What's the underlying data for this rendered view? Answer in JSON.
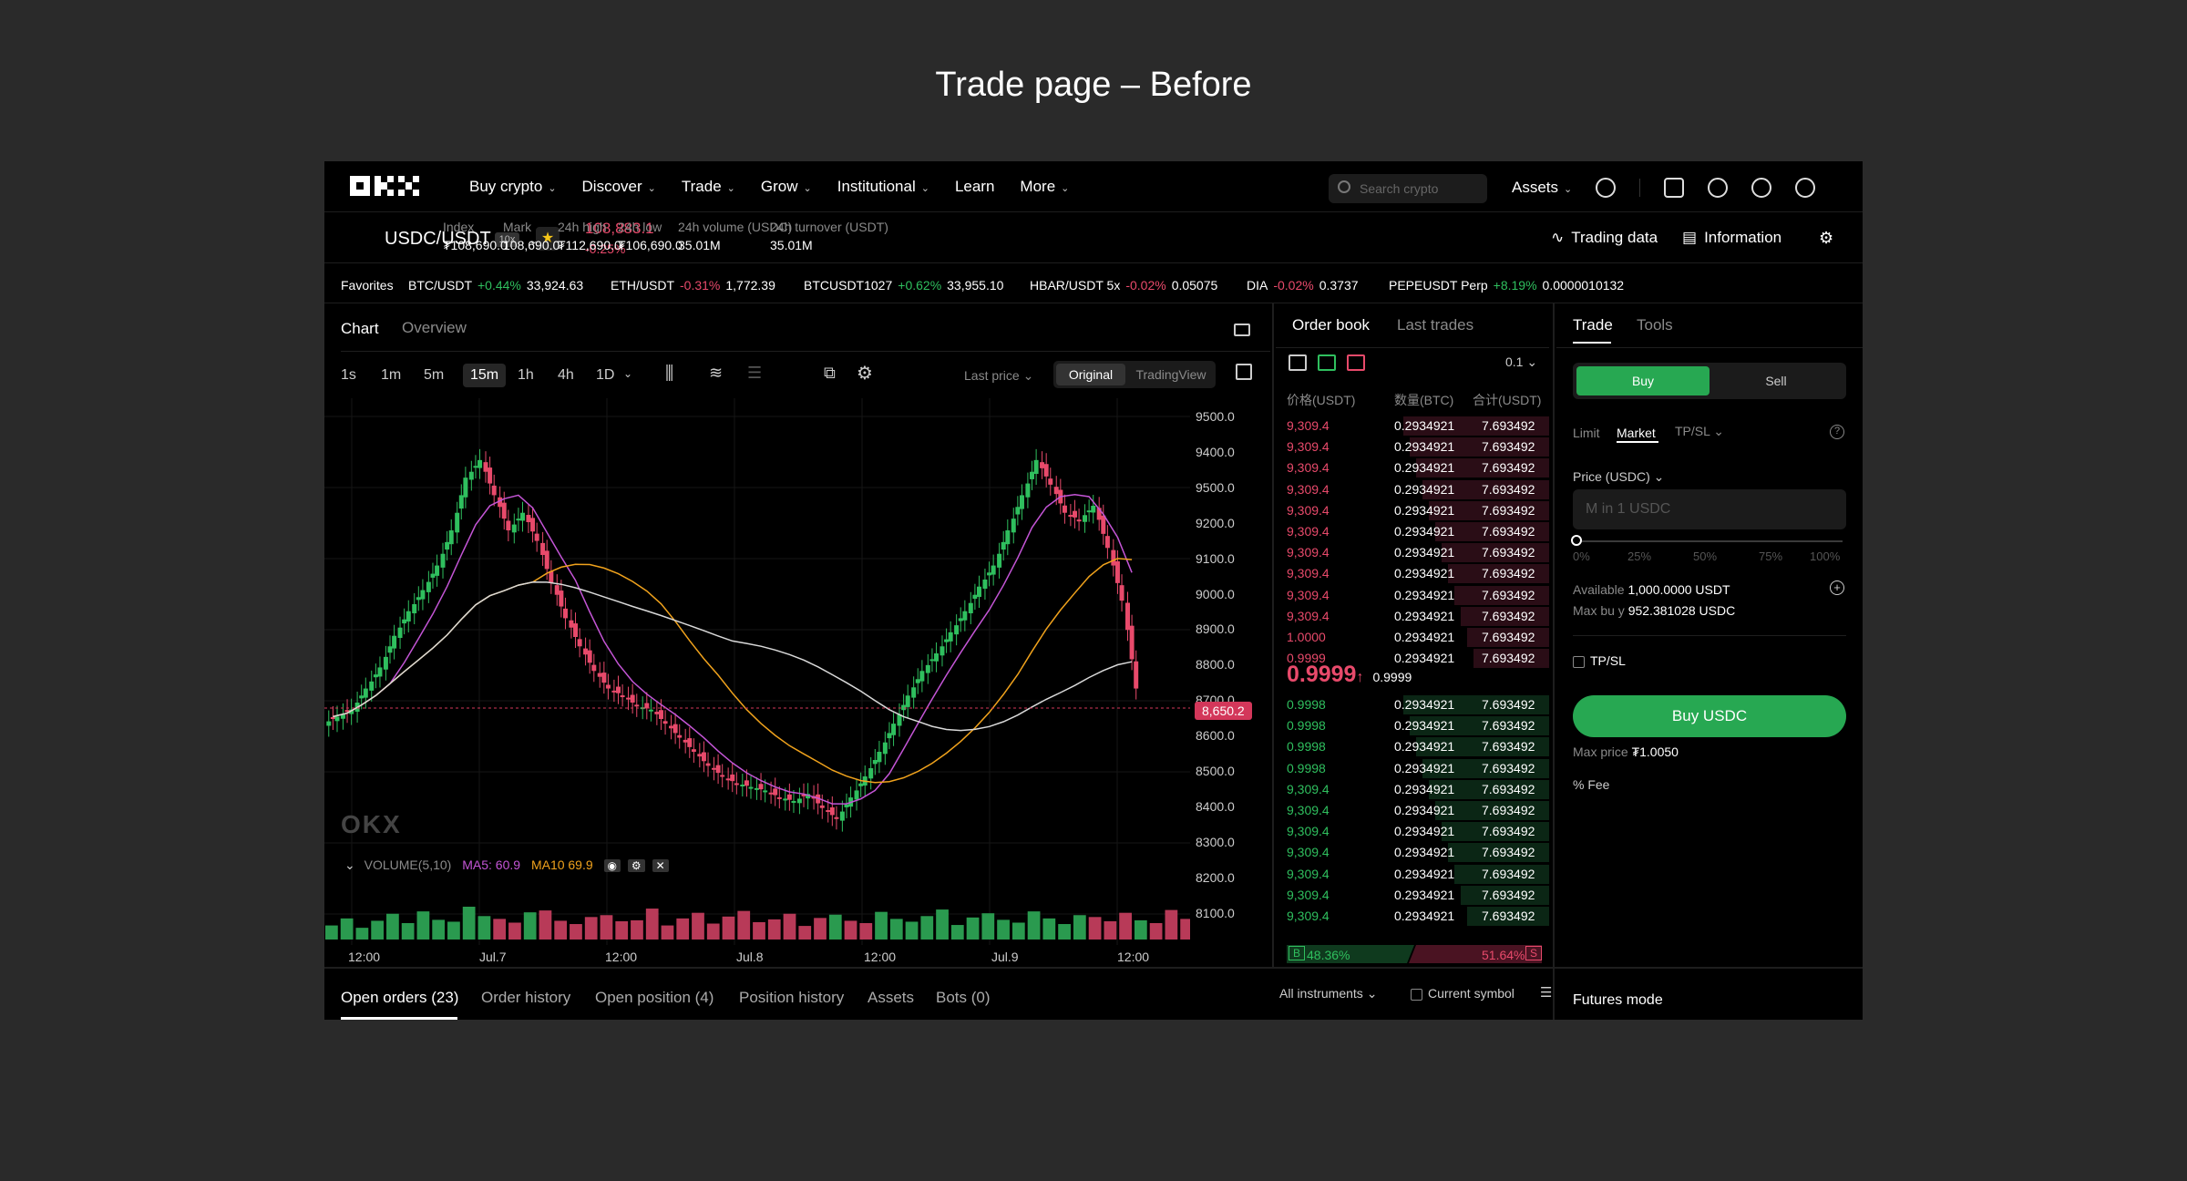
{
  "page_title": "Trade page – Before",
  "nav": {
    "logo": "OKX",
    "items": [
      "Buy crypto",
      "Discover",
      "Trade",
      "Grow",
      "Institutional",
      "Learn",
      "More"
    ],
    "has_chevron": [
      true,
      true,
      true,
      true,
      true,
      false,
      true
    ],
    "search_placeholder": "Search crypto",
    "assets": "Assets"
  },
  "ticker": {
    "pair": "USDC/USDT",
    "leverage": "10x",
    "last_price": "108,883.1",
    "change": "-0.25%",
    "stats": [
      {
        "label": "Index",
        "value": "₮108,690.0"
      },
      {
        "label": "Mark",
        "value": "108,690.0"
      },
      {
        "label": "24h high",
        "value": "₮112,690.0"
      },
      {
        "label": "24h low",
        "value": "₮106,690.0"
      },
      {
        "label": "24h volume (USDC)",
        "value": "35.01M"
      },
      {
        "label": "24h turnover (USDT)",
        "value": "35.01M"
      }
    ],
    "trading_data": "Trading data",
    "information": "Information"
  },
  "favorites": {
    "label": "Favorites",
    "items": [
      {
        "name": "BTC/USDT",
        "change": "+0.44%",
        "price": "33,924.63",
        "up": true
      },
      {
        "name": "ETH/USDT",
        "change": "-0.31%",
        "price": "1,772.39",
        "up": false
      },
      {
        "name": "BTCUSDT1027",
        "change": "+0.62%",
        "price": "33,955.10",
        "up": true
      },
      {
        "name": "HBAR/USDT 5x",
        "change": "-0.02%",
        "price": "0.05075",
        "up": false
      },
      {
        "name": "DIA",
        "change": "-0.02%",
        "price": "0.3737",
        "up": false
      },
      {
        "name": "PEPEUSDT Perp",
        "change": "+8.19%",
        "price": "0.0000010132",
        "up": true
      }
    ]
  },
  "chart_panel": {
    "tabs": [
      "Chart",
      "Overview"
    ],
    "timeframes": [
      "1s",
      "1m",
      "5m",
      "15m",
      "1h",
      "4h",
      "1D"
    ],
    "active_timeframe": "15m",
    "price_source": "Last price",
    "views": [
      "Original",
      "TradingView"
    ],
    "active_view": "Original",
    "watermark": "OKX",
    "volume_label": "VOLUME(5,10)",
    "ma5": "MA5: 60.9",
    "ma10": "MA10 69.9",
    "current_price_tag": "8,650.2"
  },
  "chart_data": {
    "type": "candlestick",
    "y_ticks": [
      "9500.0",
      "9400.0",
      "9500.0",
      "9200.0",
      "9100.0",
      "9000.0",
      "8900.0",
      "8800.0",
      "8700.0",
      "8600.0",
      "8500.0",
      "8400.0",
      "8300.0",
      "8200.0",
      "8100.0"
    ],
    "x_ticks": [
      "12:00",
      "Jul.7",
      "12:00",
      "Jul.8",
      "12:00",
      "Jul.9",
      "12:00"
    ],
    "ylim": [
      8100,
      9500
    ],
    "close_series": [
      8620,
      8640,
      8700,
      8760,
      8850,
      8920,
      8980,
      9050,
      9150,
      9300,
      9350,
      9250,
      9150,
      9200,
      9120,
      9000,
      8900,
      8820,
      8750,
      8700,
      8680,
      8650,
      8640,
      8600,
      8560,
      8520,
      8480,
      8450,
      8430,
      8420,
      8410,
      8390,
      8380,
      8400,
      8360,
      8330,
      8390,
      8450,
      8520,
      8600,
      8680,
      8750,
      8800,
      8860,
      8920,
      8990,
      9050,
      9150,
      9250,
      9350,
      9280,
      9200,
      9180,
      9220,
      9100,
      8950,
      8700
    ],
    "volumes": [
      30,
      45,
      25,
      40,
      55,
      35,
      60,
      42,
      38,
      70,
      50,
      44,
      36,
      58,
      62,
      40,
      33,
      48,
      52,
      39,
      41,
      66,
      30,
      45,
      57,
      34,
      49,
      61,
      37,
      43,
      55,
      29,
      46,
      53,
      40,
      35,
      59,
      44,
      38,
      50,
      64,
      31,
      47,
      56,
      42,
      36,
      60,
      45,
      33,
      52,
      48,
      39,
      57,
      41,
      35,
      63,
      44
    ],
    "ma_series": [
      {
        "name": "MA5",
        "color": "#c455d6"
      },
      {
        "name": "MA10",
        "color": "#f0a21c"
      }
    ],
    "grid": true
  },
  "order_book": {
    "tabs": [
      "Order book",
      "Last trades"
    ],
    "precision": "0.1",
    "headers": [
      "价格(USDT)",
      "数量(BTC)",
      "合计(USDT)"
    ],
    "asks": [
      [
        "9,309.4",
        "0.2934921",
        "7.693492"
      ],
      [
        "9,309.4",
        "0.2934921",
        "7.693492"
      ],
      [
        "9,309.4",
        "0.2934921",
        "7.693492"
      ],
      [
        "9,309.4",
        "0.2934921",
        "7.693492"
      ],
      [
        "9,309.4",
        "0.2934921",
        "7.693492"
      ],
      [
        "9,309.4",
        "0.2934921",
        "7.693492"
      ],
      [
        "9,309.4",
        "0.2934921",
        "7.693492"
      ],
      [
        "9,309.4",
        "0.2934921",
        "7.693492"
      ],
      [
        "9,309.4",
        "0.2934921",
        "7.693492"
      ],
      [
        "9,309.4",
        "0.2934921",
        "7.693492"
      ],
      [
        "1.0000",
        "0.2934921",
        "7.693492"
      ],
      [
        "0.9999",
        "0.2934921",
        "7.693492"
      ]
    ],
    "mid_price": "0.9999",
    "mid_sub": "0.9999",
    "bids": [
      [
        "0.9998",
        "0.2934921",
        "7.693492"
      ],
      [
        "0.9998",
        "0.2934921",
        "7.693492"
      ],
      [
        "0.9998",
        "0.2934921",
        "7.693492"
      ],
      [
        "0.9998",
        "0.2934921",
        "7.693492"
      ],
      [
        "9,309.4",
        "0.2934921",
        "7.693492"
      ],
      [
        "9,309.4",
        "0.2934921",
        "7.693492"
      ],
      [
        "9,309.4",
        "0.2934921",
        "7.693492"
      ],
      [
        "9,309.4",
        "0.2934921",
        "7.693492"
      ],
      [
        "9,309.4",
        "0.2934921",
        "7.693492"
      ],
      [
        "9,309.4",
        "0.2934921",
        "7.693492"
      ],
      [
        "9,309.4",
        "0.2934921",
        "7.693492"
      ]
    ],
    "buy_ratio": "48.36%",
    "sell_ratio": "51.64%",
    "buy_letter": "B",
    "sell_letter": "S"
  },
  "trade_panel": {
    "tabs": [
      "Trade",
      "Tools"
    ],
    "buy": "Buy",
    "sell": "Sell",
    "order_types": [
      "Limit",
      "Market",
      "TP/SL"
    ],
    "active_order_type": "Market",
    "price_label": "Price (USDC)",
    "input_placeholder": "M in 1 USDC",
    "slider_marks": [
      "0%",
      "25%",
      "50%",
      "75%",
      "100%"
    ],
    "available_label": "Available",
    "available_value": "1,000.0000 USDT",
    "max_buy_label": "Max bu y",
    "max_buy_value": "952.381028 USDC",
    "tpsl": "TP/SL",
    "buy_button": "Buy USDC",
    "max_price_label": "Max price",
    "max_price_value": "₮1.0050",
    "fee": "Fee"
  },
  "bottom": {
    "tabs": [
      "Open orders (23)",
      "Order history",
      "Open position (4)",
      "Position history",
      "Assets",
      "Bots (0)"
    ],
    "active_tab": "Open orders (23)",
    "all_instruments": "All instruments",
    "current_symbol": "Current symbol",
    "futures_mode": "Futures mode"
  },
  "colors": {
    "up": "#2fbf5e",
    "down": "#e84a6b",
    "accent_buy": "#27a852",
    "background": "#000000"
  }
}
